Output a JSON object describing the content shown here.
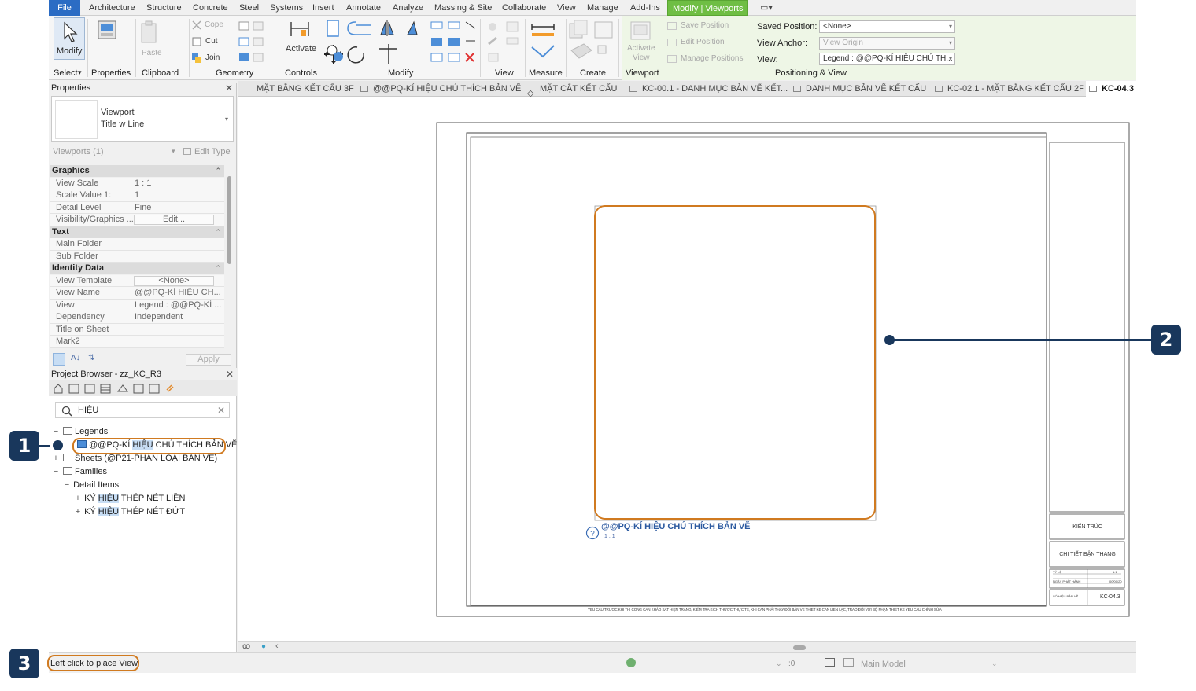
{
  "ribbon": {
    "tabs": [
      "File",
      "Architecture",
      "Structure",
      "Concrete",
      "Steel",
      "Systems",
      "Insert",
      "Annotate",
      "Analyze",
      "Massing & Site",
      "Collaborate",
      "View",
      "Manage",
      "Add-Ins",
      "Modify | Viewports"
    ],
    "quick_access_glyph": "▭▾",
    "groups": [
      "Select",
      "Properties",
      "Clipboard",
      "Geometry",
      "Controls",
      "Modify",
      "View",
      "Measure",
      "Create",
      "Viewport",
      "Positioning & View"
    ],
    "select_dropdown": "▾",
    "modify_label": "Modify",
    "properties_label": "Properties",
    "paste_label": "Paste",
    "cope_label": "Cope",
    "cut_label": "Cut",
    "join_label": "Join",
    "activate_label": "Activate",
    "activate_view_label": "Activate\nView",
    "save_position_label": "Save Position",
    "edit_position_label": "Edit Position",
    "manage_positions_label": "Manage Positions",
    "saved_position_label": "Saved Position:",
    "saved_position_value": "<None>",
    "view_anchor_label": "View Anchor:",
    "view_anchor_value": "View Origin",
    "view_label": "View:",
    "view_value": "Legend : @@PQ-KÍ HIỆU CHÚ TH..."
  },
  "view_tabs": [
    {
      "label": "MẶT BẰNG KẾT CẤU 3F"
    },
    {
      "label": "@@PQ-KÍ HIỆU CHÚ THÍCH BẢN VẼ"
    },
    {
      "label": "MẶT CẮT KẾT CẤU"
    },
    {
      "label": "KC-00.1 - DANH MỤC BẢN VẼ KẾT..."
    },
    {
      "label": "DANH MỤC BẢN VẼ KẾT CẤU"
    },
    {
      "label": "KC-02.1 - MẶT BẰNG KẾT CẤU 2F"
    },
    {
      "label": "KC-04.3"
    }
  ],
  "properties": {
    "title": "Properties",
    "close": "✕",
    "type_family": "Viewport",
    "type_name": "Title w Line",
    "instance_filter": "Viewports (1)",
    "edit_type": "Edit Type",
    "sections": [
      {
        "name": "Graphics",
        "rows": [
          {
            "name": "View Scale",
            "value": "1 : 1",
            "box": false
          },
          {
            "name": "Scale Value    1:",
            "value": "1",
            "box": false
          },
          {
            "name": "Detail Level",
            "value": "Fine",
            "box": false
          },
          {
            "name": "Visibility/Graphics ...",
            "value": "Edit...",
            "box": true
          }
        ]
      },
      {
        "name": "Text",
        "rows": [
          {
            "name": "Main Folder",
            "value": "",
            "box": false
          },
          {
            "name": "Sub Folder",
            "value": "",
            "box": false
          }
        ]
      },
      {
        "name": "Identity Data",
        "rows": [
          {
            "name": "View Template",
            "value": "<None>",
            "box": true
          },
          {
            "name": "View Name",
            "value": "@@PQ-KÍ HIỆU CH...",
            "box": false
          },
          {
            "name": "View",
            "value": "Legend : @@PQ-KÍ ...",
            "box": false
          },
          {
            "name": "Dependency",
            "value": "Independent",
            "box": false
          },
          {
            "name": "Title on Sheet",
            "value": "",
            "box": false
          },
          {
            "name": "Mark2",
            "value": "",
            "box": false
          }
        ]
      }
    ],
    "apply": "Apply"
  },
  "browser": {
    "title": "Project Browser - zz_KC_R3",
    "close": "✕",
    "search_value": "HIỆU",
    "tree": {
      "legends": "Legends",
      "legend_item": {
        "pre": "@@PQ-KÍ ",
        "hl": "HIỆU",
        "post": " CHÚ THÍCH BẢN VẼ"
      },
      "sheets": "Sheets (@P21-PHÂN LOẠI BẢN VẼ)",
      "families": "Families",
      "detail_items": "Detail Items",
      "item1": {
        "pre": "KÝ ",
        "hl": "HIỆU",
        "post": " THÉP NÉT LIỀN"
      },
      "item2": {
        "pre": "KÝ ",
        "hl": "HIỆU",
        "post": " THÉP NÉT ĐỨT"
      }
    }
  },
  "sheet": {
    "viewport_title": "@@PQ-KÍ HIỆU CHÚ THÍCH BẢN VẼ",
    "viewport_scale": "1 : 1",
    "title_block": {
      "project": "KIẾN TRÚC",
      "sheet_title": "CHI TIẾT BẬN THANG",
      "scale_label": "TỶ LỆ",
      "scale_value": "1:1",
      "date_label": "NGÀY PHÁT HÀNH",
      "date_value": "00/00/20",
      "number_label": "SỐ HIỆU BẢN VẼ",
      "number_value": "KC-04.3"
    },
    "footer_note": "YÊU CẦU TRƯỚC KHI THI CÔNG CẦN KHẢO SÁT HIỆN TRẠNG, KIỂM TRA KÍCH THƯỚC THỰC TẾ, KHI CẦN PHẢI THAY ĐỔI BẢN VẼ THIẾT KẾ CẦN LIÊN LẠC, TRAO ĐỔI VỚI BỘ PHẬN THIẾT KẾ YÊU CẦU CHỈNH SỬA"
  },
  "status": {
    "message": "Left click to place View",
    "filter_count": ":0",
    "model": "Main Model"
  },
  "callouts": {
    "one": "1",
    "two": "2",
    "three": "3"
  },
  "colors": {
    "accent_tab": "#6fbe44",
    "file_tab": "#2b6cc4",
    "callout": "#19375c",
    "highlight": "#d07a20"
  }
}
